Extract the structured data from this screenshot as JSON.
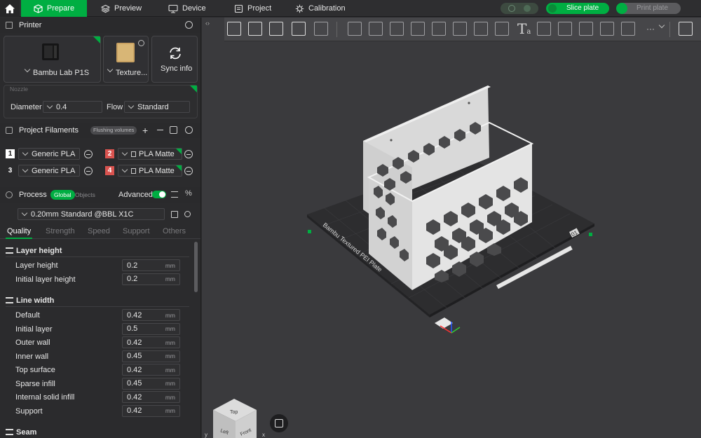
{
  "nav": {
    "home_icon": "home-icon",
    "tabs": [
      {
        "label": "Prepare",
        "icon": "cube-icon",
        "active": true
      },
      {
        "label": "Preview",
        "icon": "layers-icon",
        "active": false
      },
      {
        "label": "Device",
        "icon": "device-icon",
        "active": false
      },
      {
        "label": "Project",
        "icon": "project-icon",
        "active": false
      },
      {
        "label": "Calibration",
        "icon": "calibration-icon",
        "active": false
      }
    ],
    "slice_label": "Slice plate",
    "print_label": "Print plate",
    "accent": "#00ae42"
  },
  "printer": {
    "title": "Printer",
    "model_label": "Bambu Lab P1S",
    "plate_label": "Texture...",
    "sync_label": "Sync info",
    "nozzle_caption": "Nozzle",
    "diameter_label": "Diameter",
    "diameter_value": "0.4",
    "flow_label": "Flow",
    "flow_value": "Standard"
  },
  "filaments": {
    "title": "Project Filaments",
    "flushing_label": "Flushing volumes",
    "items": [
      {
        "index": "1",
        "name": "Generic PLA",
        "badge_color": "#ffffff"
      },
      {
        "index": "2",
        "name": "PLA Matte",
        "badge_color": "#d9534f"
      },
      {
        "index": "3",
        "name": "Generic PLA",
        "badge_color": "#2b2b2d"
      },
      {
        "index": "4",
        "name": "PLA Matte",
        "badge_color": "#d9534f"
      }
    ]
  },
  "process": {
    "title": "Process",
    "global_label": "Global",
    "objects_label": "Objects",
    "advanced_label": "Advanced",
    "preset": "0.20mm Standard @BBL X1C",
    "tabs": [
      "Quality",
      "Strength",
      "Speed",
      "Support",
      "Others"
    ],
    "active_tab": "Quality"
  },
  "quality": {
    "layer_height_title": "Layer height",
    "line_width_title": "Line width",
    "seam_title": "Seam",
    "unit": "mm",
    "layer_rows": [
      {
        "label": "Layer height",
        "value": "0.2"
      },
      {
        "label": "Initial layer height",
        "value": "0.2"
      }
    ],
    "line_rows": [
      {
        "label": "Default",
        "value": "0.42"
      },
      {
        "label": "Initial layer",
        "value": "0.5"
      },
      {
        "label": "Outer wall",
        "value": "0.42"
      },
      {
        "label": "Inner wall",
        "value": "0.45"
      },
      {
        "label": "Top surface",
        "value": "0.42"
      },
      {
        "label": "Sparse infill",
        "value": "0.45"
      },
      {
        "label": "Internal solid infill",
        "value": "0.42"
      },
      {
        "label": "Support",
        "value": "0.42"
      }
    ]
  },
  "viewport": {
    "plate_label": "Bambu Textured PEI Plate",
    "plate_number": "01",
    "cube_top": "Top",
    "cube_left": "Left",
    "cube_front": "Front",
    "axis_x": "x",
    "axis_y": "y",
    "more_label": "···"
  }
}
